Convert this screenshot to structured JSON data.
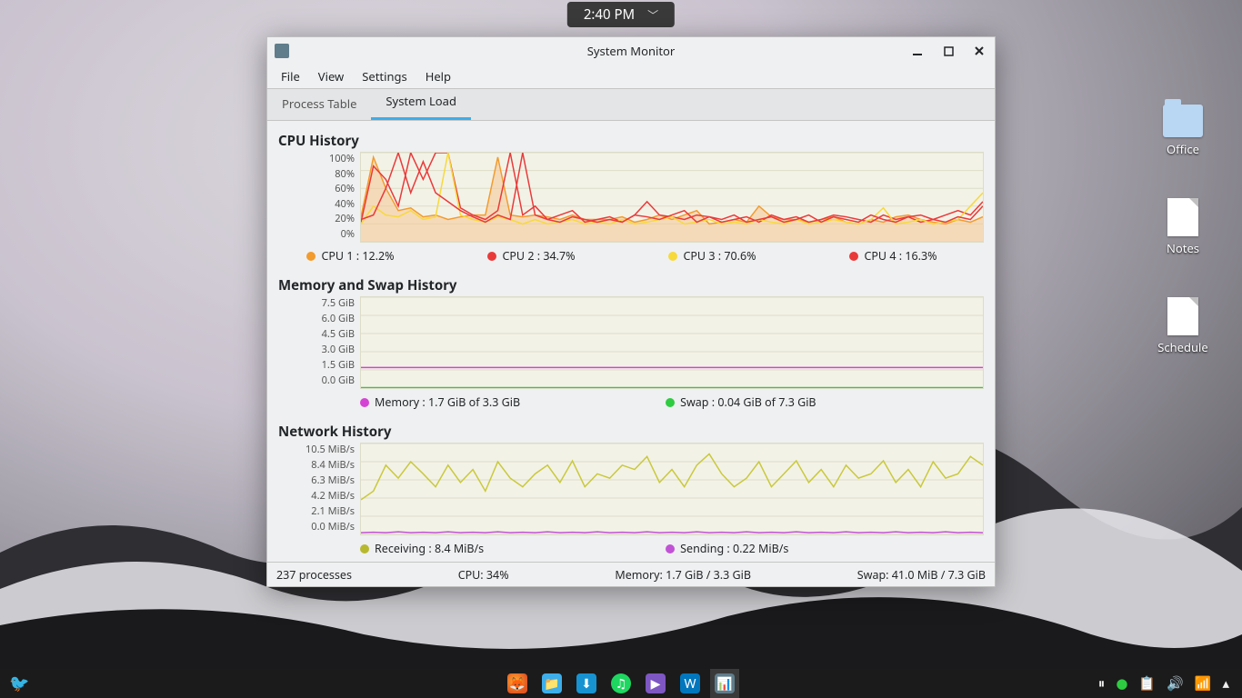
{
  "clock": {
    "time": "2:40 PM"
  },
  "desktop_icons": [
    {
      "label": "Office",
      "kind": "folder"
    },
    {
      "label": "Notes",
      "kind": "file"
    },
    {
      "label": "Schedule",
      "kind": "file"
    }
  ],
  "taskbar": {
    "apps": [
      "firefox",
      "filemanager",
      "software",
      "spotify",
      "player",
      "wps",
      "sysmonitor"
    ]
  },
  "window": {
    "title": "System Monitor",
    "menu": [
      "File",
      "View",
      "Settings",
      "Help"
    ],
    "tabs": [
      "Process Table",
      "System Load"
    ],
    "active_tab": 1
  },
  "cpu": {
    "title": "CPU History",
    "yticks": [
      "100%",
      "80%",
      "60%",
      "40%",
      "20%",
      "0%"
    ],
    "legend": [
      {
        "label": "CPU 1 : 12.2%",
        "color": "#f29b2e"
      },
      {
        "label": "CPU 2 : 34.7%",
        "color": "#e93a3a"
      },
      {
        "label": "CPU 3 : 70.6%",
        "color": "#f7d93b"
      },
      {
        "label": "CPU 4 : 16.3%",
        "color": "#e93a3a"
      }
    ]
  },
  "mem": {
    "title": "Memory and Swap History",
    "yticks": [
      "7.5 GiB",
      "6.0 GiB",
      "4.5 GiB",
      "3.0 GiB",
      "1.5 GiB",
      "0.0 GiB"
    ],
    "legend": [
      {
        "label": "Memory : 1.7 GiB of 3.3 GiB",
        "color": "#d543d5"
      },
      {
        "label": "Swap : 0.04 GiB of 7.3 GiB",
        "color": "#2ecc40"
      }
    ]
  },
  "net": {
    "title": "Network History",
    "yticks": [
      "10.5 MiB/s",
      "8.4 MiB/s",
      "6.3 MiB/s",
      "4.2 MiB/s",
      "2.1 MiB/s",
      "0.0 MiB/s"
    ],
    "legend": [
      {
        "label": "Receiving : 8.4 MiB/s",
        "color": "#b8b82e"
      },
      {
        "label": "Sending : 0.22 MiB/s",
        "color": "#c152d6"
      }
    ]
  },
  "statusbar": {
    "processes": "237 processes",
    "cpu": "CPU: 34%",
    "mem": "Memory: 1.7 GiB / 3.3 GiB",
    "swap": "Swap: 41.0 MiB / 7.3 GiB"
  },
  "chart_data": [
    {
      "type": "line",
      "title": "CPU History",
      "xlabel": "",
      "ylabel": "%",
      "ylim": [
        0,
        100
      ],
      "x": [
        0,
        2,
        4,
        6,
        8,
        10,
        12,
        14,
        16,
        18,
        20,
        22,
        24,
        26,
        28,
        30,
        32,
        34,
        36,
        38,
        40,
        42,
        44,
        46,
        48,
        50,
        52,
        54,
        56,
        58,
        60,
        62,
        64,
        66,
        68,
        70,
        72,
        74,
        76,
        78,
        80,
        82,
        84,
        86,
        88,
        90,
        92,
        94,
        96,
        98,
        100
      ],
      "series": [
        {
          "name": "CPU 1",
          "color": "#f29b2e",
          "values": [
            28,
            95,
            60,
            35,
            38,
            28,
            30,
            25,
            28,
            30,
            30,
            95,
            30,
            28,
            30,
            28,
            25,
            30,
            25,
            25,
            25,
            28,
            22,
            25,
            30,
            25,
            30,
            35,
            20,
            22,
            25,
            22,
            40,
            28,
            25,
            25,
            22,
            25,
            28,
            22,
            20,
            25,
            22,
            28,
            30,
            25,
            22,
            20,
            25,
            22,
            28
          ]
        },
        {
          "name": "CPU 2",
          "color": "#e93a3a",
          "values": [
            22,
            85,
            70,
            40,
            100,
            70,
            100,
            100,
            38,
            30,
            25,
            35,
            100,
            30,
            40,
            25,
            30,
            35,
            22,
            25,
            28,
            22,
            30,
            45,
            30,
            28,
            25,
            30,
            28,
            22,
            25,
            28,
            22,
            30,
            25,
            28,
            22,
            25,
            30,
            28,
            25,
            22,
            30,
            25,
            28,
            22,
            25,
            30,
            35,
            30,
            45
          ]
        },
        {
          "name": "CPU 3",
          "color": "#f7d93b",
          "values": [
            20,
            40,
            30,
            28,
            35,
            25,
            28,
            100,
            30,
            25,
            22,
            28,
            25,
            20,
            25,
            20,
            22,
            25,
            20,
            22,
            20,
            25,
            20,
            22,
            25,
            28,
            20,
            22,
            25,
            20,
            22,
            20,
            25,
            22,
            20,
            25,
            20,
            22,
            25,
            22,
            20,
            25,
            38,
            20,
            22,
            25,
            20,
            22,
            25,
            40,
            55
          ]
        },
        {
          "name": "CPU 4",
          "color": "#e93a3a",
          "values": [
            25,
            30,
            60,
            100,
            55,
            90,
            55,
            45,
            35,
            28,
            22,
            30,
            25,
            100,
            30,
            25,
            22,
            28,
            25,
            22,
            25,
            22,
            30,
            28,
            25,
            30,
            35,
            22,
            28,
            25,
            30,
            22,
            25,
            28,
            22,
            25,
            30,
            22,
            28,
            25,
            22,
            30,
            25,
            22,
            28,
            30,
            25,
            22,
            28,
            25,
            40
          ]
        }
      ]
    },
    {
      "type": "line",
      "title": "Memory and Swap History",
      "xlabel": "",
      "ylabel": "GiB",
      "ylim": [
        0,
        7.5
      ],
      "x": [
        0,
        100
      ],
      "series": [
        {
          "name": "Memory",
          "color": "#d543d5",
          "values": [
            1.7,
            1.7
          ]
        },
        {
          "name": "Swap",
          "color": "#2ecc40",
          "values": [
            0.04,
            0.04
          ]
        }
      ]
    },
    {
      "type": "line",
      "title": "Network History",
      "xlabel": "",
      "ylabel": "MiB/s",
      "ylim": [
        0,
        10.5
      ],
      "x": [
        0,
        2,
        4,
        6,
        8,
        10,
        12,
        14,
        16,
        18,
        20,
        22,
        24,
        26,
        28,
        30,
        32,
        34,
        36,
        38,
        40,
        42,
        44,
        46,
        48,
        50,
        52,
        54,
        56,
        58,
        60,
        62,
        64,
        66,
        68,
        70,
        72,
        74,
        76,
        78,
        80,
        82,
        84,
        86,
        88,
        90,
        92,
        94,
        96,
        98,
        100
      ],
      "series": [
        {
          "name": "Receiving",
          "color": "#c9c93b",
          "values": [
            4.0,
            5.0,
            8.0,
            6.5,
            8.4,
            7.0,
            5.5,
            8.0,
            6.0,
            7.5,
            5.0,
            8.4,
            6.5,
            5.5,
            7.0,
            8.0,
            6.0,
            8.5,
            5.5,
            7.0,
            6.5,
            8.0,
            7.5,
            9.0,
            6.0,
            7.5,
            5.5,
            8.0,
            9.3,
            7.0,
            5.5,
            6.5,
            8.4,
            5.5,
            7.0,
            8.5,
            6.0,
            7.5,
            5.5,
            8.0,
            6.5,
            7.0,
            8.5,
            6.0,
            7.5,
            5.5,
            8.4,
            6.5,
            7.0,
            9.0,
            8.0
          ]
        },
        {
          "name": "Sending",
          "color": "#c152d6",
          "values": [
            0.2,
            0.25,
            0.2,
            0.3,
            0.2,
            0.25,
            0.2,
            0.3,
            0.2,
            0.25,
            0.2,
            0.3,
            0.2,
            0.25,
            0.2,
            0.3,
            0.2,
            0.25,
            0.2,
            0.3,
            0.2,
            0.25,
            0.2,
            0.3,
            0.2,
            0.25,
            0.2,
            0.3,
            0.2,
            0.25,
            0.2,
            0.3,
            0.2,
            0.25,
            0.2,
            0.3,
            0.2,
            0.25,
            0.2,
            0.3,
            0.2,
            0.25,
            0.2,
            0.3,
            0.2,
            0.25,
            0.2,
            0.3,
            0.2,
            0.25,
            0.2
          ]
        }
      ]
    }
  ]
}
